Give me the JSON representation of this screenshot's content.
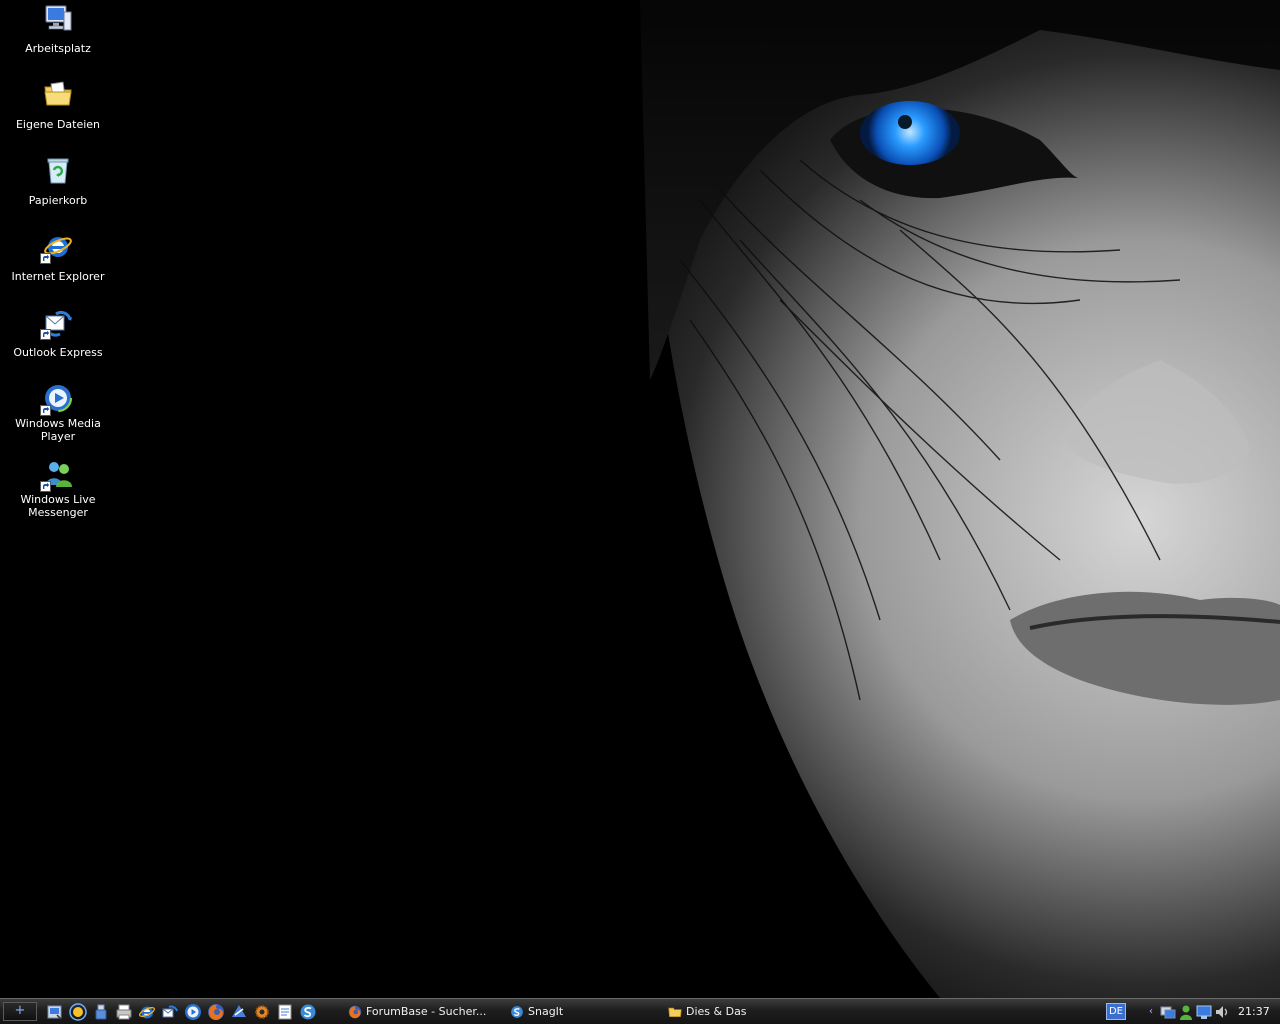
{
  "desktop": {
    "icons": [
      {
        "label": "Arbeitsplatz",
        "icon": "my-computer-icon",
        "shortcut": false
      },
      {
        "label": "Eigene Dateien",
        "icon": "my-documents-folder-icon",
        "shortcut": false
      },
      {
        "label": "Papierkorb",
        "icon": "recycle-bin-icon",
        "shortcut": false
      },
      {
        "label": "Internet Explorer",
        "icon": "internet-explorer-icon",
        "shortcut": true
      },
      {
        "label": "Outlook Express",
        "icon": "outlook-express-icon",
        "shortcut": true
      },
      {
        "label": "Windows Media Player",
        "icon": "windows-media-player-icon",
        "shortcut": true
      },
      {
        "label": "Windows Live Messenger",
        "icon": "windows-live-messenger-icon",
        "shortcut": true
      }
    ],
    "wallpaper": "black-and-white portrait with blue eye"
  },
  "taskbar": {
    "start_label": "+",
    "quick_launch": [
      "show-desktop-icon",
      "sun-icon",
      "usb-icon",
      "printer-icon",
      "internet-explorer-icon",
      "outlook-express-icon",
      "media-player-icon",
      "firefox-icon",
      "program-icon",
      "gear-icon",
      "notepad-icon",
      "snagit-icon"
    ],
    "tasks": [
      {
        "label": "ForumBase - Sucher...",
        "icon": "firefox-icon"
      },
      {
        "label": "SnagIt",
        "icon": "snagit-icon"
      },
      {
        "label": "Dies & Das",
        "icon": "folder-icon"
      }
    ],
    "language": "DE",
    "tray_expand": "‹",
    "tray_icons": [
      "network-icon",
      "messenger-icon",
      "display-icon",
      "volume-icon"
    ],
    "clock": "21:37"
  },
  "colors": {
    "taskbar_bg": "#1e1e1e",
    "eye_blue": "#1e90ff",
    "lang_badge": "#3a6fd0"
  }
}
